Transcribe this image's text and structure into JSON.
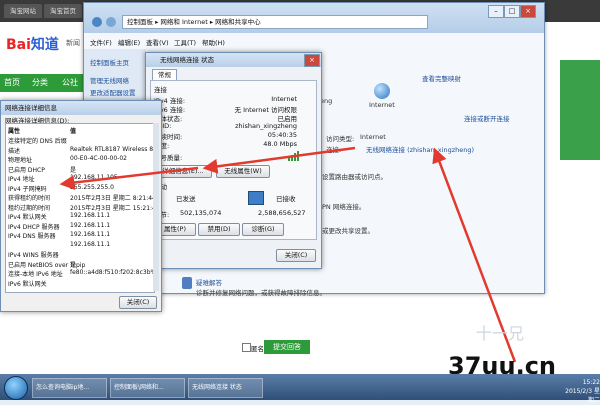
{
  "browser": {
    "tabs": [
      "淘宝网站",
      "淘宝首页",
      "网站"
    ],
    "logo_red": "Bai",
    "logo_blue": "知道",
    "new_text": "新闻",
    "nav": [
      "首页",
      "分类",
      "公社"
    ]
  },
  "nc": {
    "address": "控制面板 ▸ 网络和 Internet ▸ 网络和共享中心",
    "menu": [
      "文件(F)",
      "编辑(E)",
      "查看(V)",
      "工具(T)",
      "帮助(H)"
    ],
    "sidebar": [
      "控制面板主页",
      "管理无线网络",
      "更改适配器设置"
    ],
    "view_full_map": "查看完整映射",
    "internet_label": "Internet",
    "connect_or_disconnect": "连接或断开连接",
    "access_type_label": "访问类型:",
    "access_type_value": "Internet",
    "connection_label": "连接:",
    "connection_value": "无线网络连接 (zhishan_xingzheng)",
    "partial_label": "eng",
    "desc1": "设置路由器或访问点。",
    "desc2": "PN 网络连接。",
    "desc3": "或更改共享设置。",
    "troubleshoot": "疑难解答",
    "troubleshoot_desc": "诊断并修复网络问题，或获得故障排除信息。"
  },
  "status": {
    "title": "无线网络连接 状态",
    "tab_general": "常规",
    "section_connection": "连接",
    "rows": [
      {
        "label": "IPv4 连接:",
        "value": "Internet"
      },
      {
        "label": "IPv6 连接:",
        "value": "无 Internet 访问权限"
      },
      {
        "label": "媒体状态:",
        "value": "已启用"
      },
      {
        "label": "SSID:",
        "value": "zhishan_xingzheng"
      },
      {
        "label": "持续时间:",
        "value": "05:40:35"
      },
      {
        "label": "速度:",
        "value": "48.0 Mbps"
      }
    ],
    "signal_label": "信号质量:",
    "details_button": "详细信息(E)...",
    "wireless_button": "无线属性(W)",
    "activity": "活动",
    "sent_label": "已发送",
    "received_label": "已接收",
    "bytes_label": "字节:",
    "bytes_sent": "502,135,074",
    "bytes_received": "2,588,656,527",
    "properties_button": "属性(P)",
    "disable_button": "禁用(D)",
    "diagnose_button": "诊断(G)",
    "close_button": "关闭(C)"
  },
  "details": {
    "title": "网络连接详细信息",
    "caption": "网络连接详细信息(D):",
    "col_property": "属性",
    "col_value": "值",
    "rows": [
      {
        "p": "连接特定的 DNS 后缀",
        "v": ""
      },
      {
        "p": "描述",
        "v": "Realtek RTL8187 Wireless 802.1"
      },
      {
        "p": "物理地址",
        "v": "00-E0-4C-00-00-02"
      },
      {
        "p": "已启用 DHCP",
        "v": "是"
      },
      {
        "p": "IPv4 地址",
        "v": "192.168.11.105"
      },
      {
        "p": "IPv4 子网掩码",
        "v": "255.255.255.0"
      },
      {
        "p": "获得租约的时间",
        "v": "2015年2月3日 星期二 8:21:44"
      },
      {
        "p": "租约过期的时间",
        "v": "2015年2月3日 星期二 15:21:44"
      },
      {
        "p": "IPv4 默认网关",
        "v": "192.168.11.1"
      },
      {
        "p": "IPv4 DHCP 服务器",
        "v": "192.168.11.1"
      },
      {
        "p": "IPv4 DNS 服务器",
        "v": "192.168.11.1"
      },
      {
        "p": "",
        "v": "192.168.11.1"
      },
      {
        "p": "IPv4 WINS 服务器",
        "v": ""
      },
      {
        "p": "已启用 NetBIOS over Tcpip",
        "v": "是"
      },
      {
        "p": "连接-本地 IPv6 地址",
        "v": "fe80::a4d8:f510:f202:8c3b%12"
      },
      {
        "p": "IPv6 默认网关",
        "v": ""
      }
    ],
    "close_button": "关闭(C)"
  },
  "bottom": {
    "anonymous": "匿名",
    "submit": "提交回答",
    "watermark": "37uu.cn",
    "watermark_faint": "十一兄"
  },
  "taskbar": {
    "items": [
      "怎么查询电脑ip地...",
      "控制面板\\网络和...",
      "无线网络连接 状态"
    ],
    "time": "15:22",
    "date": "2015/2/3 星期二"
  },
  "colors": {
    "arrow": "#e23a2e",
    "accent_green": "#2e9b3a"
  }
}
